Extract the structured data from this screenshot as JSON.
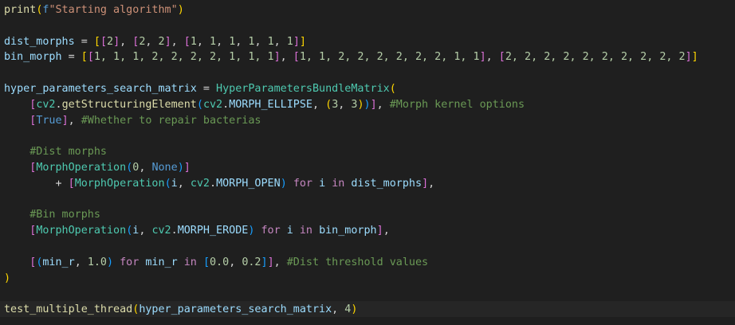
{
  "editor": {
    "lines": [
      {
        "tokens": [
          {
            "t": "print",
            "c": "fn"
          },
          {
            "t": "(",
            "c": "b1"
          },
          {
            "t": "f",
            "c": "kw"
          },
          {
            "t": "\"Starting algorithm\"",
            "c": "str"
          },
          {
            "t": ")",
            "c": "b1"
          }
        ]
      },
      {
        "tokens": []
      },
      {
        "tokens": [
          {
            "t": "dist_morphs",
            "c": "var"
          },
          {
            "t": " = ",
            "c": "op"
          },
          {
            "t": "[",
            "c": "b1"
          },
          {
            "t": "[",
            "c": "b2"
          },
          {
            "t": "2",
            "c": "num"
          },
          {
            "t": "]",
            "c": "b2"
          },
          {
            "t": ", ",
            "c": "op"
          },
          {
            "t": "[",
            "c": "b2"
          },
          {
            "t": "2",
            "c": "num"
          },
          {
            "t": ", ",
            "c": "op"
          },
          {
            "t": "2",
            "c": "num"
          },
          {
            "t": "]",
            "c": "b2"
          },
          {
            "t": ", ",
            "c": "op"
          },
          {
            "t": "[",
            "c": "b2"
          },
          {
            "t": "1",
            "c": "num"
          },
          {
            "t": ", ",
            "c": "op"
          },
          {
            "t": "1",
            "c": "num"
          },
          {
            "t": ", ",
            "c": "op"
          },
          {
            "t": "1",
            "c": "num"
          },
          {
            "t": ", ",
            "c": "op"
          },
          {
            "t": "1",
            "c": "num"
          },
          {
            "t": ", ",
            "c": "op"
          },
          {
            "t": "1",
            "c": "num"
          },
          {
            "t": ", ",
            "c": "op"
          },
          {
            "t": "1",
            "c": "num"
          },
          {
            "t": "]",
            "c": "b2"
          },
          {
            "t": "]",
            "c": "b1"
          }
        ]
      },
      {
        "tokens": [
          {
            "t": "bin_morph",
            "c": "var"
          },
          {
            "t": " = ",
            "c": "op"
          },
          {
            "t": "[",
            "c": "b1"
          },
          {
            "t": "[",
            "c": "b2"
          },
          {
            "t": "1, 1, 1, 2, 2, 2, 2, 1, 1, 1",
            "c": "num"
          },
          {
            "t": "]",
            "c": "b2"
          },
          {
            "t": ", ",
            "c": "op"
          },
          {
            "t": "[",
            "c": "b2"
          },
          {
            "t": "1, 1, 2, 2, 2, 2, 2, 2, 1, 1",
            "c": "num"
          },
          {
            "t": "]",
            "c": "b2"
          },
          {
            "t": ", ",
            "c": "op"
          },
          {
            "t": "[",
            "c": "b2"
          },
          {
            "t": "2, 2, 2, 2, 2, 2, 2, 2, 2, 2",
            "c": "num"
          },
          {
            "t": "]",
            "c": "b2"
          },
          {
            "t": "]",
            "c": "b1"
          }
        ]
      },
      {
        "tokens": []
      },
      {
        "tokens": [
          {
            "t": "hyper_parameters_search_matrix",
            "c": "var"
          },
          {
            "t": " = ",
            "c": "op"
          },
          {
            "t": "HyperParametersBundleMatrix",
            "c": "cls"
          },
          {
            "t": "(",
            "c": "b1"
          }
        ]
      },
      {
        "tokens": [
          {
            "t": "    ",
            "c": "op"
          },
          {
            "t": "[",
            "c": "b2"
          },
          {
            "t": "cv2",
            "c": "cls"
          },
          {
            "t": ".",
            "c": "op"
          },
          {
            "t": "getStructuringElement",
            "c": "fn"
          },
          {
            "t": "(",
            "c": "b3"
          },
          {
            "t": "cv2",
            "c": "cls"
          },
          {
            "t": ".",
            "c": "op"
          },
          {
            "t": "MORPH_ELLIPSE",
            "c": "var"
          },
          {
            "t": ", ",
            "c": "op"
          },
          {
            "t": "(",
            "c": "b1"
          },
          {
            "t": "3",
            "c": "num"
          },
          {
            "t": ", ",
            "c": "op"
          },
          {
            "t": "3",
            "c": "num"
          },
          {
            "t": ")",
            "c": "b1"
          },
          {
            "t": ")",
            "c": "b3"
          },
          {
            "t": "]",
            "c": "b2"
          },
          {
            "t": ", ",
            "c": "op"
          },
          {
            "t": "#Morph kernel options",
            "c": "cmt"
          }
        ]
      },
      {
        "tokens": [
          {
            "t": "    ",
            "c": "op"
          },
          {
            "t": "[",
            "c": "b2"
          },
          {
            "t": "True",
            "c": "kw"
          },
          {
            "t": "]",
            "c": "b2"
          },
          {
            "t": ", ",
            "c": "op"
          },
          {
            "t": "#Whether to repair bacterias",
            "c": "cmt"
          }
        ]
      },
      {
        "tokens": []
      },
      {
        "tokens": [
          {
            "t": "    ",
            "c": "op"
          },
          {
            "t": "#Dist morphs",
            "c": "cmt"
          }
        ]
      },
      {
        "tokens": [
          {
            "t": "    ",
            "c": "op"
          },
          {
            "t": "[",
            "c": "b2"
          },
          {
            "t": "MorphOperation",
            "c": "cls"
          },
          {
            "t": "(",
            "c": "b3"
          },
          {
            "t": "0",
            "c": "num"
          },
          {
            "t": ", ",
            "c": "op"
          },
          {
            "t": "None",
            "c": "kw"
          },
          {
            "t": ")",
            "c": "b3"
          },
          {
            "t": "]",
            "c": "b2"
          }
        ]
      },
      {
        "tokens": [
          {
            "t": "        + ",
            "c": "op"
          },
          {
            "t": "[",
            "c": "b2"
          },
          {
            "t": "MorphOperation",
            "c": "cls"
          },
          {
            "t": "(",
            "c": "b3"
          },
          {
            "t": "i",
            "c": "var"
          },
          {
            "t": ", ",
            "c": "op"
          },
          {
            "t": "cv2",
            "c": "cls"
          },
          {
            "t": ".",
            "c": "op"
          },
          {
            "t": "MORPH_OPEN",
            "c": "var"
          },
          {
            "t": ")",
            "c": "b3"
          },
          {
            "t": " ",
            "c": "op"
          },
          {
            "t": "for",
            "c": "ctl"
          },
          {
            "t": " ",
            "c": "op"
          },
          {
            "t": "i",
            "c": "var"
          },
          {
            "t": " ",
            "c": "op"
          },
          {
            "t": "in",
            "c": "ctl"
          },
          {
            "t": " ",
            "c": "op"
          },
          {
            "t": "dist_morphs",
            "c": "var"
          },
          {
            "t": "]",
            "c": "b2"
          },
          {
            "t": ",",
            "c": "op"
          }
        ]
      },
      {
        "tokens": []
      },
      {
        "tokens": [
          {
            "t": "    ",
            "c": "op"
          },
          {
            "t": "#Bin morphs",
            "c": "cmt"
          }
        ]
      },
      {
        "tokens": [
          {
            "t": "    ",
            "c": "op"
          },
          {
            "t": "[",
            "c": "b2"
          },
          {
            "t": "MorphOperation",
            "c": "cls"
          },
          {
            "t": "(",
            "c": "b3"
          },
          {
            "t": "i",
            "c": "var"
          },
          {
            "t": ", ",
            "c": "op"
          },
          {
            "t": "cv2",
            "c": "cls"
          },
          {
            "t": ".",
            "c": "op"
          },
          {
            "t": "MORPH_ERODE",
            "c": "var"
          },
          {
            "t": ")",
            "c": "b3"
          },
          {
            "t": " ",
            "c": "op"
          },
          {
            "t": "for",
            "c": "ctl"
          },
          {
            "t": " ",
            "c": "op"
          },
          {
            "t": "i",
            "c": "var"
          },
          {
            "t": " ",
            "c": "op"
          },
          {
            "t": "in",
            "c": "ctl"
          },
          {
            "t": " ",
            "c": "op"
          },
          {
            "t": "bin_morph",
            "c": "var"
          },
          {
            "t": "]",
            "c": "b2"
          },
          {
            "t": ",",
            "c": "op"
          }
        ]
      },
      {
        "tokens": []
      },
      {
        "tokens": [
          {
            "t": "    ",
            "c": "op"
          },
          {
            "t": "[",
            "c": "b2"
          },
          {
            "t": "(",
            "c": "b3"
          },
          {
            "t": "min_r",
            "c": "var"
          },
          {
            "t": ", ",
            "c": "op"
          },
          {
            "t": "1.0",
            "c": "num"
          },
          {
            "t": ")",
            "c": "b3"
          },
          {
            "t": " ",
            "c": "op"
          },
          {
            "t": "for",
            "c": "ctl"
          },
          {
            "t": " ",
            "c": "op"
          },
          {
            "t": "min_r",
            "c": "var"
          },
          {
            "t": " ",
            "c": "op"
          },
          {
            "t": "in",
            "c": "ctl"
          },
          {
            "t": " ",
            "c": "op"
          },
          {
            "t": "[",
            "c": "b3"
          },
          {
            "t": "0.0",
            "c": "num"
          },
          {
            "t": ", ",
            "c": "op"
          },
          {
            "t": "0.2",
            "c": "num"
          },
          {
            "t": "]",
            "c": "b3"
          },
          {
            "t": "]",
            "c": "b2"
          },
          {
            "t": ", ",
            "c": "op"
          },
          {
            "t": "#Dist threshold values",
            "c": "cmt"
          }
        ]
      },
      {
        "tokens": [
          {
            "t": ")",
            "c": "b1"
          }
        ]
      },
      {
        "tokens": []
      },
      {
        "tokens": [
          {
            "t": "test_multiple_thread",
            "c": "fn"
          },
          {
            "t": "(",
            "c": "b1"
          },
          {
            "t": "hyper_parameters_search_matrix",
            "c": "var"
          },
          {
            "t": ", ",
            "c": "op"
          },
          {
            "t": "4",
            "c": "num"
          },
          {
            "t": ")",
            "c": "b1"
          }
        ]
      }
    ]
  }
}
